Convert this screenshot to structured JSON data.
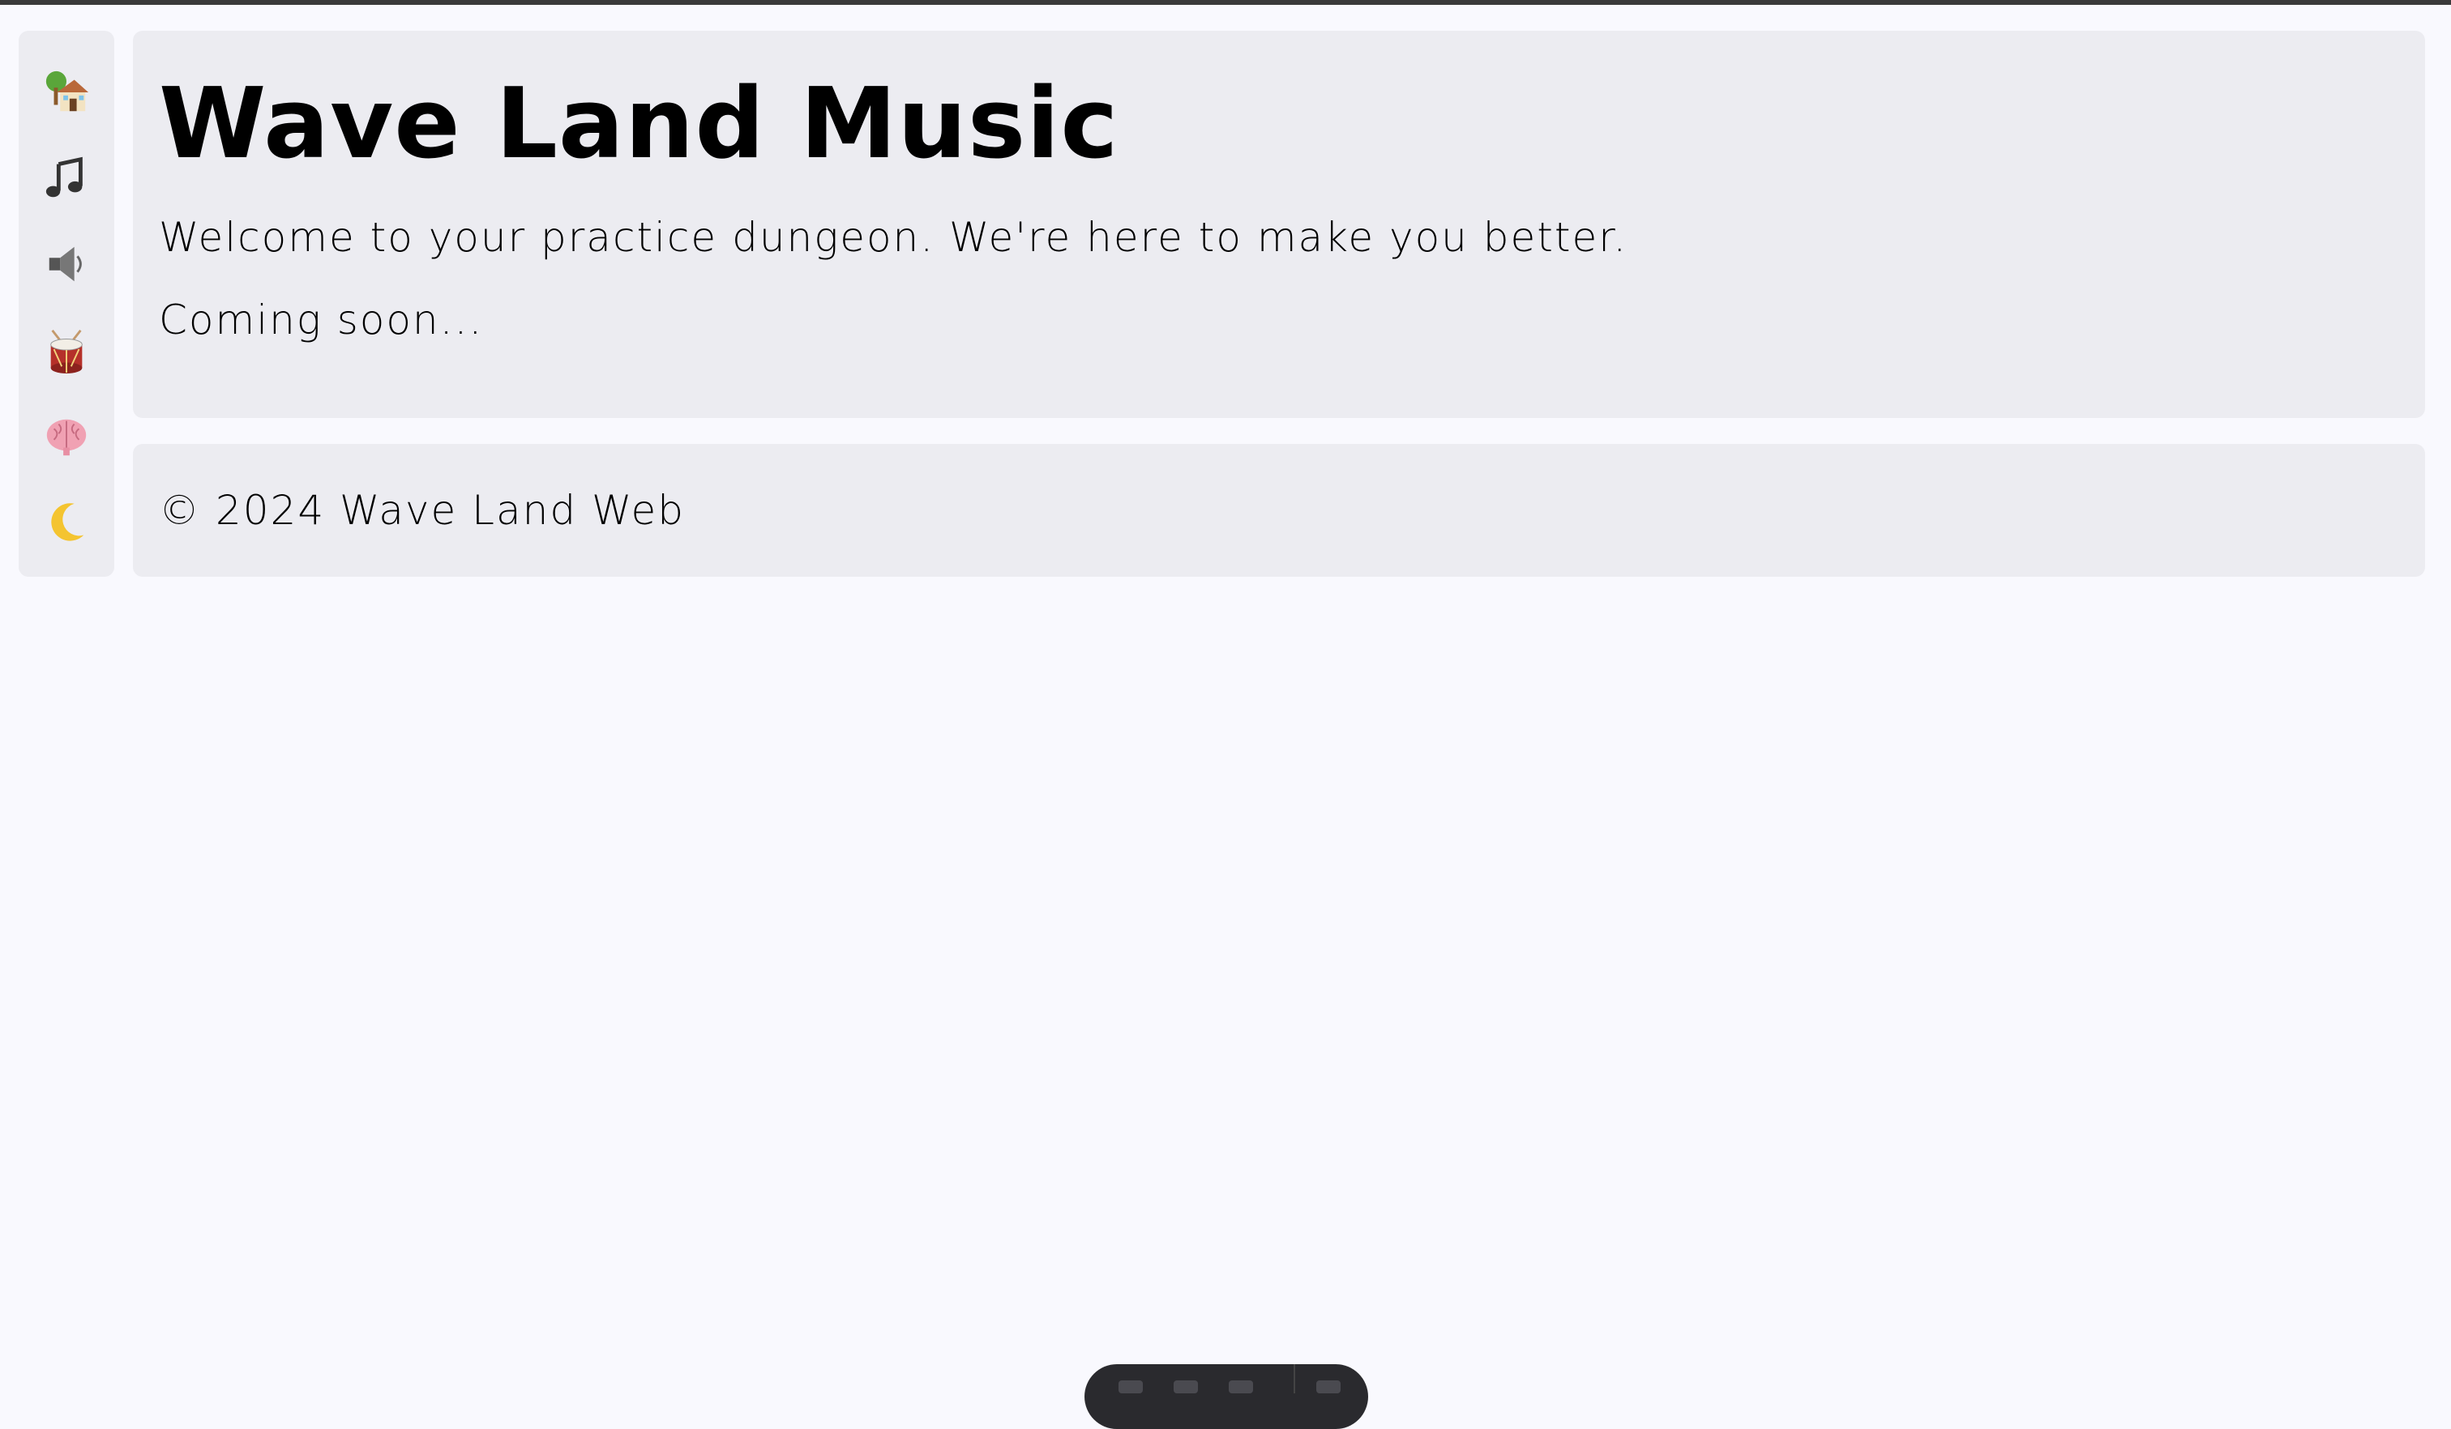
{
  "sidebar": {
    "items": [
      {
        "icon": "house-with-tree-icon",
        "label": "Home"
      },
      {
        "icon": "music-note-icon",
        "label": "Music"
      },
      {
        "icon": "speaker-icon",
        "label": "Audio"
      },
      {
        "icon": "drum-icon",
        "label": "Drums"
      },
      {
        "icon": "brain-icon",
        "label": "Training"
      },
      {
        "icon": "moon-icon",
        "label": "Dark mode"
      }
    ]
  },
  "hero": {
    "title": "Wave Land Music",
    "lead": "Welcome to your practice dungeon. We're here to make you better.",
    "status": "Coming soon..."
  },
  "footer": {
    "copyright": "© 2024 Wave Land Web"
  },
  "colors": {
    "background": "#f9f9fe",
    "panel": "#ececf1",
    "text": "#000000"
  }
}
